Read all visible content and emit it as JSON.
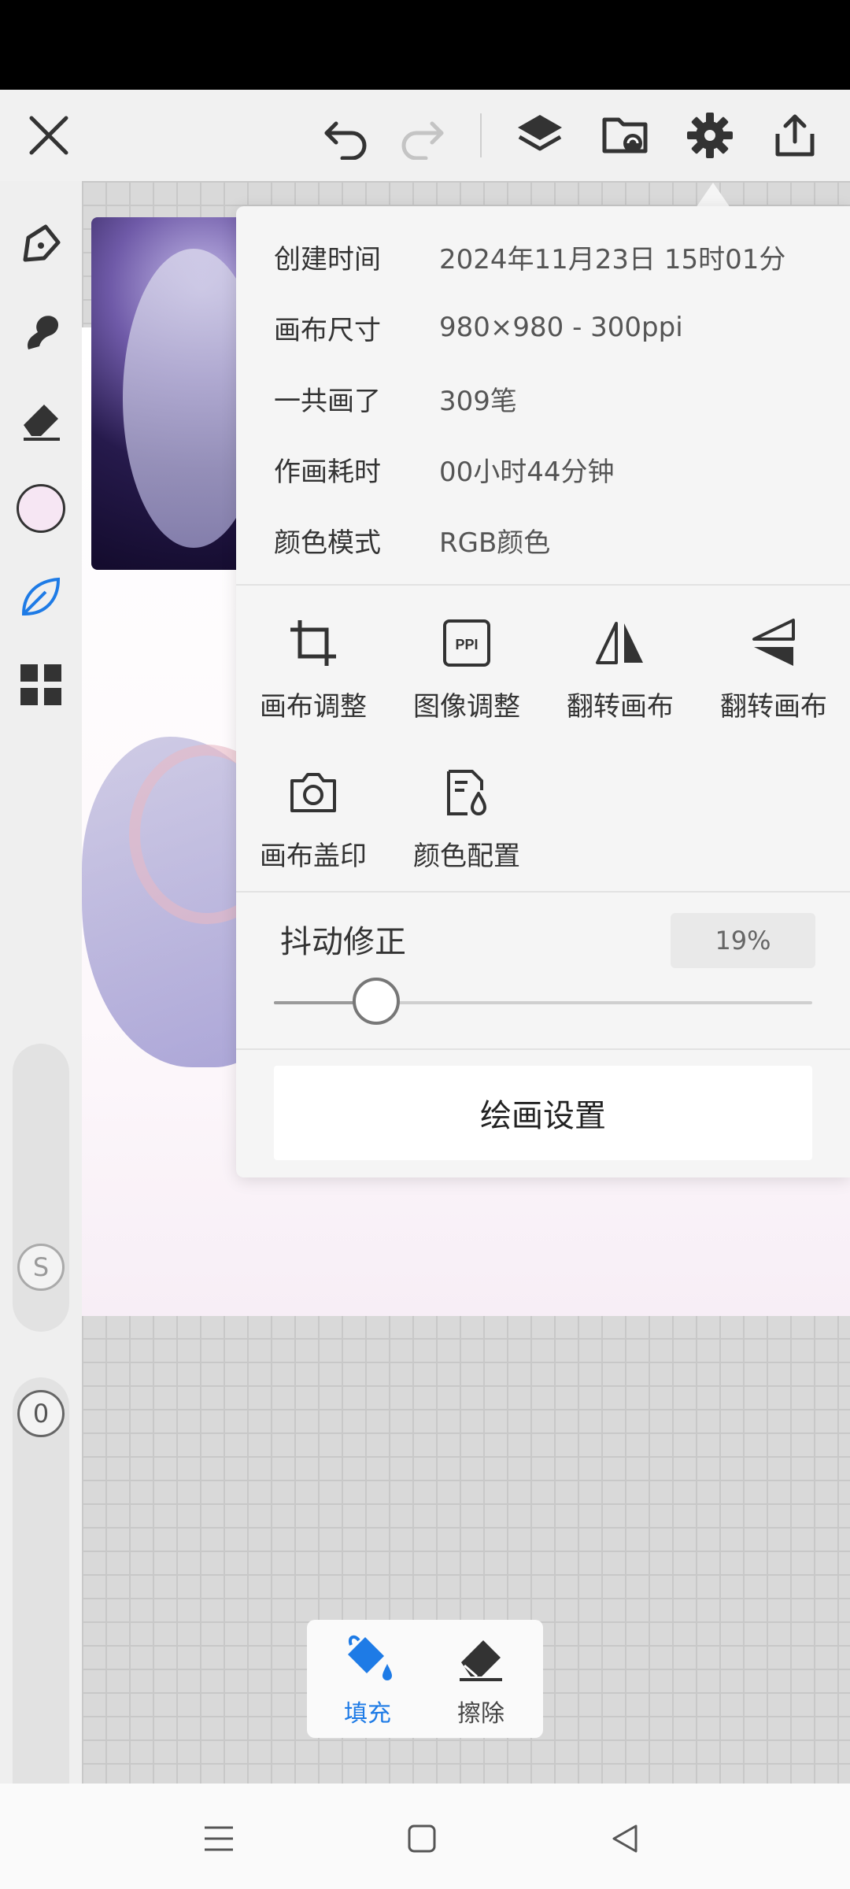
{
  "canvas_info": {
    "rows": [
      {
        "label": "创建时间",
        "value": "2024年11月23日 15时01分"
      },
      {
        "label": "画布尺寸",
        "value": "980×980 - 300ppi"
      },
      {
        "label": "一共画了",
        "value": "309笔"
      },
      {
        "label": "作画耗时",
        "value": "00小时44分钟"
      },
      {
        "label": "颜色模式",
        "value": "RGB颜色"
      }
    ]
  },
  "actions": [
    {
      "label": "画布调整",
      "icon": "crop-icon"
    },
    {
      "label": "图像调整",
      "icon": "ppi-icon",
      "icon_text": "PPI"
    },
    {
      "label": "翻转画布",
      "icon": "flip-horizontal-icon"
    },
    {
      "label": "翻转画布",
      "icon": "flip-vertical-icon"
    },
    {
      "label": "画布盖印",
      "icon": "camera-icon"
    },
    {
      "label": "颜色配置",
      "icon": "color-profile-icon"
    }
  ],
  "stabilizer": {
    "label": "抖动修正",
    "value_text": "19%",
    "value": 0.19
  },
  "settings_button": "绘画设置",
  "left_rail": {
    "slider_s_label": "S",
    "slider_o_label": "0",
    "current_color": "#f6e6f3"
  },
  "bottom_tools": [
    {
      "label": "填充",
      "icon": "fill-bucket-icon",
      "active": true
    },
    {
      "label": "擦除",
      "icon": "eraser-icon",
      "active": false
    }
  ],
  "colors": {
    "accent": "#1e7be6",
    "icon": "#333333"
  }
}
